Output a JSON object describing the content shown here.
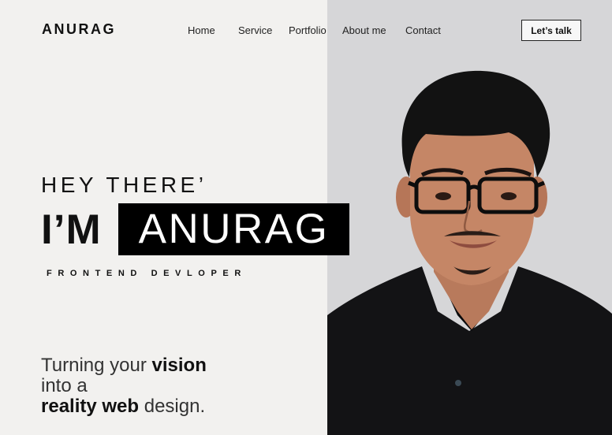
{
  "brand": {
    "logo": "ANURAG"
  },
  "nav": {
    "items": [
      "Home",
      "Service",
      "Portfolio",
      "About me",
      "Contact"
    ],
    "cta": "Let’s talk"
  },
  "hero": {
    "greeting": "HEY THERE’",
    "im": "I’M",
    "name": "ANURAG",
    "role": "FRONTEND DEVLOPER",
    "tagline": {
      "part1": "Turning your",
      "part2": "vision",
      "part3": "into a",
      "part4": "reality web",
      "part5": "design."
    }
  },
  "colors": {
    "left_bg": "#f2f1ef",
    "right_bg": "#d6d6d8",
    "accent": "#000000"
  }
}
